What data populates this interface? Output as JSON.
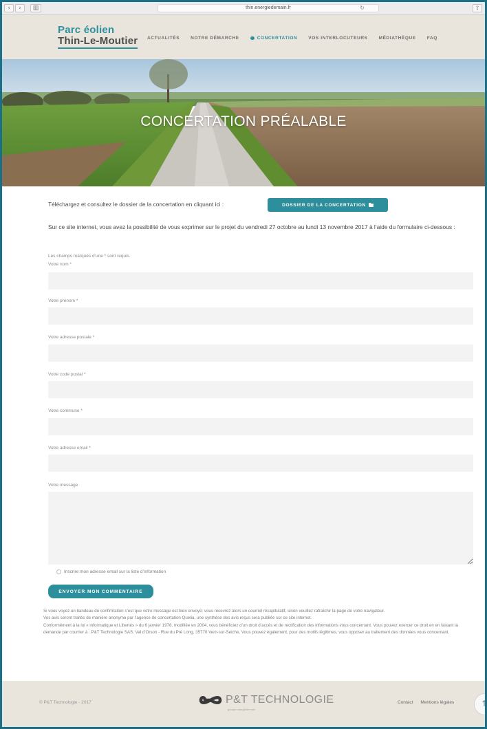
{
  "browser": {
    "url": "thin.energiedemain.fr",
    "back_glyph": "‹",
    "forward_glyph": "›",
    "sidebar_glyph": "▥",
    "reload_glyph": "↻",
    "share_glyph": "⇧"
  },
  "header": {
    "logo_line1": "Parc éolien",
    "logo_line2": "Thin-Le-Moutier",
    "menu": [
      {
        "label": "ACTUALITÉS"
      },
      {
        "label": "NOTRE DÉMARCHE"
      },
      {
        "label": "CONCERTATION"
      },
      {
        "label": "VOS INTERLOCUTEURS"
      },
      {
        "label": "MÉDIATHÈQUE"
      },
      {
        "label": "FAQ"
      }
    ]
  },
  "hero": {
    "title": "CONCERTATION PRÉALABLE"
  },
  "intro": {
    "text": "Téléchargez et consultez le dossier de la concertation en cliquant ici :",
    "button_label": "DOSSIER DE LA CONCERTATION"
  },
  "lead": "Sur ce site internet, vous avez la possibilité de vous exprimer sur le projet du vendredi 27 octobre au lundi 13 novembre 2017 à l’aide du formulaire ci-dessous :",
  "form": {
    "required_note": "Les champs marqués d’une * sont requis.",
    "fields": [
      {
        "label": "Votre nom *",
        "value": ""
      },
      {
        "label": "Votre prénom *",
        "value": ""
      },
      {
        "label": "Votre adresse postale *",
        "value": ""
      },
      {
        "label": "Votre code postal *",
        "value": ""
      },
      {
        "label": "Votre commune *",
        "value": ""
      },
      {
        "label": "Votre adresse email *",
        "value": ""
      }
    ],
    "message_label": "Votre message",
    "newsletter_label": "Inscrire mon adresse email sur la liste d’information",
    "submit_label": "ENVOYER MON COMMENTAIRE"
  },
  "notes": [
    "Si vous voyez un bandeau de confirmation c’est que votre message est bien envoyé: vous recevrez alors un courriel récapitulatif, sinon veuillez rafraîchir la page de votre navigateur.",
    "Vos avis seront traités de manière anonyme par l’agence de concertation Quelia, une synthèse des avis reçus sera publiée sur ce site internet.",
    "Conformément à la loi « informatique et Libertés » du 6 janvier 1978, modifiée en 2004, vous bénéficiez d’un droit d’accès et de rectification des informations vous concernant. Vous pouvez exercer ce droit en en faisant la demande par courrier à : P&T Technologie SAS. Val d’Orson - Rue du Pré Long, 35770 Vern-sur-Seiche. Vous pouvez également, pour des motifs légitimes, vous opposer au traitement des données vous concernant."
  ],
  "footer": {
    "copyright": "© P&T Technologie - 2017",
    "brand": "P&T TECHNOLOGIE",
    "tagline": "groupe energiedemain",
    "links": [
      {
        "label": "Contact"
      },
      {
        "label": "Mentions légales"
      }
    ],
    "scroll_glyph": "↑"
  },
  "colors": {
    "accent": "#2d8f9b",
    "header_bg": "#e9e4dc",
    "field_bg": "#f3f3f3"
  }
}
